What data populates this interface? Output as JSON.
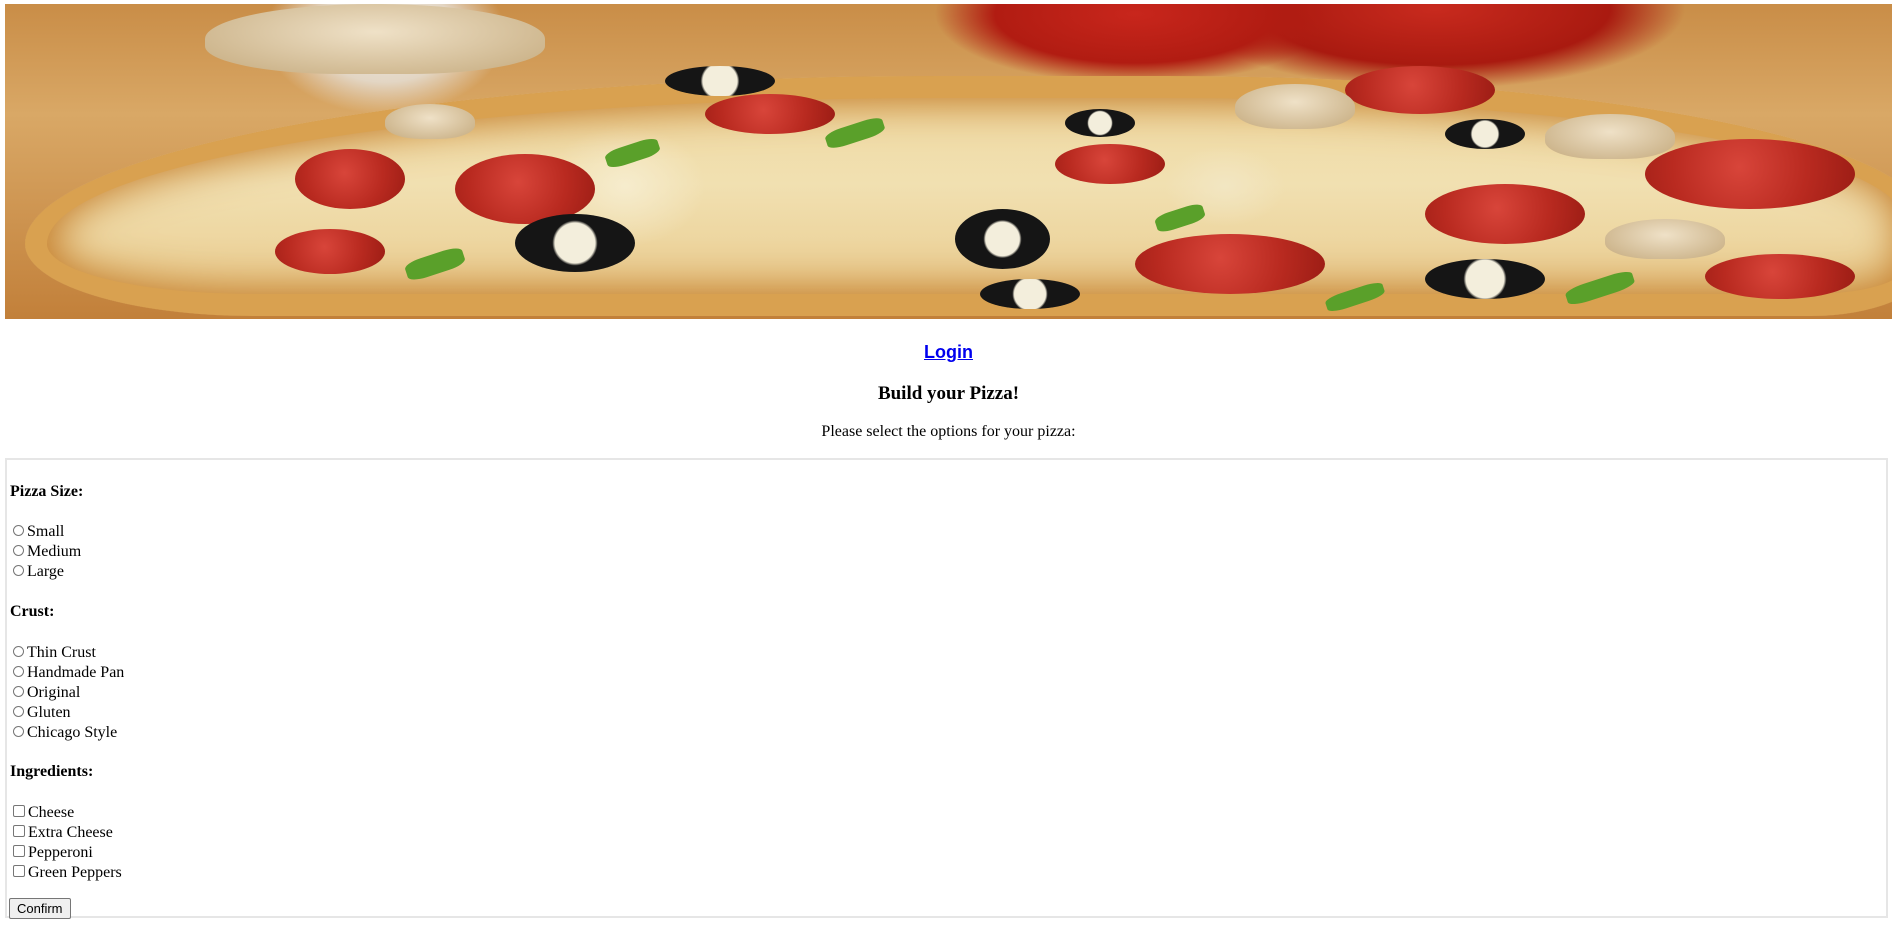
{
  "header": {
    "banner_alt": "pizza banner",
    "login_link": "Login",
    "title": "Build your Pizza!",
    "intro": "Please select the options for your pizza:"
  },
  "form": {
    "size": {
      "title": "Pizza Size:",
      "options": [
        "Small",
        "Medium",
        "Large"
      ]
    },
    "crust": {
      "title": "Crust:",
      "options": [
        "Thin Crust",
        "Handmade Pan",
        "Original",
        "Gluten",
        "Chicago Style"
      ]
    },
    "ingredients": {
      "title": "Ingredients:",
      "options": [
        "Cheese",
        "Extra Cheese",
        "Pepperoni",
        "Green Peppers"
      ]
    },
    "confirm_label": "Confirm"
  },
  "colors": {
    "link": "#0000ee",
    "border": "#e6e6e6"
  }
}
